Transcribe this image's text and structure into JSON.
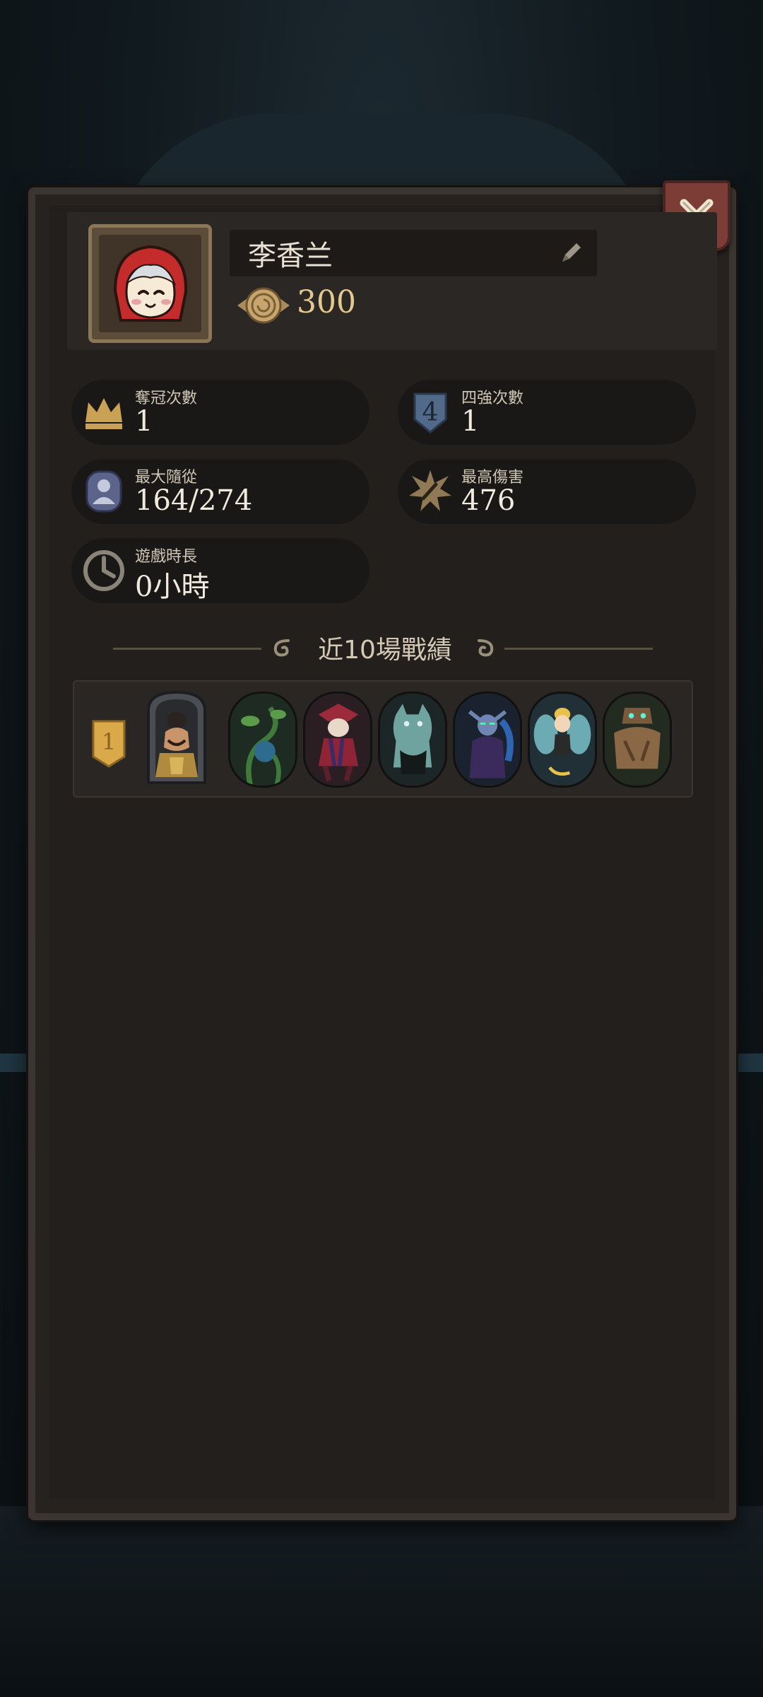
{
  "profile": {
    "name": "李香兰",
    "coins": "300"
  },
  "stats": [
    {
      "label": "奪冠次數",
      "value": "1",
      "icon": "crown-icon"
    },
    {
      "label": "四強次數",
      "value": "1",
      "icon": "top-four-shield-icon"
    },
    {
      "label": "最大隨從",
      "value": "164/274",
      "icon": "follower-icon"
    },
    {
      "label": "最高傷害",
      "value": "476",
      "icon": "damage-burst-icon"
    },
    {
      "label": "遊戲時長",
      "value": "0小時",
      "icon": "clock-icon"
    }
  ],
  "recent": {
    "title": "近10場戰績",
    "matches": [
      {
        "rank": "1",
        "heroes": [
          "hero-portrait-sultan",
          "hero-vine-plant",
          "hero-jester",
          "hero-ice-beast",
          "hero-dark-elf",
          "hero-fairy",
          "hero-wood-golem"
        ]
      }
    ]
  },
  "colors": {
    "panel": "#262220",
    "gold": "#e4c98f",
    "close_button": "#7b3d35",
    "rank_gold": "#d9a94a"
  }
}
